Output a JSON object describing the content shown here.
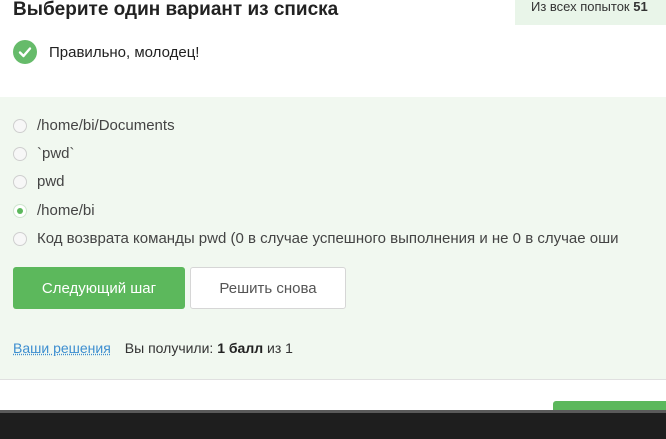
{
  "step": {
    "title": "Выберите один вариант из списка",
    "attempts_label": "Из всех попыток",
    "attempts_value": "51"
  },
  "feedback": {
    "text": "Правильно, молодец!",
    "icon": "check-circle-icon",
    "color": "#66bb6a"
  },
  "options": [
    {
      "label": "/home/bi/Documents",
      "selected": false
    },
    {
      "label": "`pwd`",
      "selected": false
    },
    {
      "label": "pwd",
      "selected": false
    },
    {
      "label": "/home/bi",
      "selected": true
    },
    {
      "label": "Код возврата команды pwd (0 в случае успешного выполнения и не 0 в случае оши",
      "selected": false
    }
  ],
  "buttons": {
    "next": "Следующий шаг",
    "retry": "Решить снова"
  },
  "result": {
    "solutions_link": "Ваши решения",
    "score_prefix": "Вы получили:",
    "score_value": "1 балл",
    "score_suffix": "из 1"
  },
  "colors": {
    "accent": "#5cb85c",
    "quiz_background": "#f1f8f0",
    "link": "#3d8ed0"
  }
}
